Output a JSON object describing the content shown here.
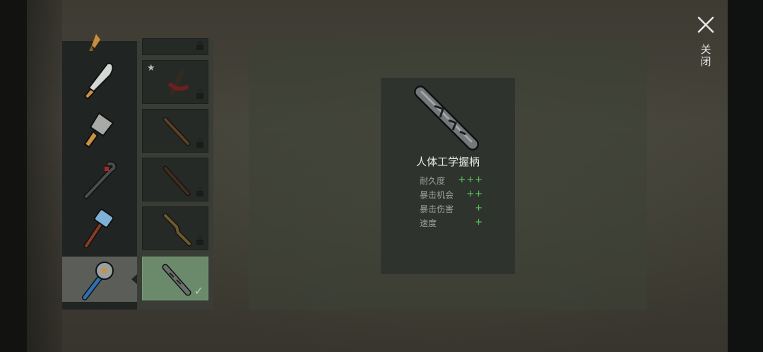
{
  "screen": "handle-selection",
  "close": {
    "label": "关闭",
    "icon": "close-icon"
  },
  "weapons": [
    {
      "name": "partial-blade",
      "icon": "partial-weapon-icon",
      "selected": false
    },
    {
      "name": "machete",
      "icon": "machete-icon",
      "selected": false
    },
    {
      "name": "cleaver",
      "icon": "cleaver-icon",
      "selected": false
    },
    {
      "name": "crowbar",
      "icon": "crowbar-icon",
      "selected": false
    },
    {
      "name": "sledgehammer",
      "icon": "hammer-icon",
      "selected": false
    },
    {
      "name": "saw-blade-club",
      "icon": "saw-club-icon",
      "selected": true
    }
  ],
  "handles": [
    {
      "icon": "handle-partial-icon",
      "locked": true,
      "starred": false,
      "equipped": false
    },
    {
      "icon": "red-wrapped-handle-icon",
      "locked": true,
      "starred": true,
      "equipped": false
    },
    {
      "icon": "wooden-handle-icon",
      "locked": true,
      "starred": false,
      "equipped": false
    },
    {
      "icon": "dark-wooden-handle-icon",
      "locked": true,
      "starred": false,
      "equipped": false
    },
    {
      "icon": "branch-handle-icon",
      "locked": true,
      "starred": false,
      "equipped": false
    },
    {
      "icon": "ergonomic-grip-icon",
      "locked": false,
      "starred": false,
      "equipped": true
    }
  ],
  "detail": {
    "icon": "ergonomic-grip-icon",
    "name": "人体工学握柄",
    "stats": [
      {
        "label": "耐久度",
        "value": "+++"
      },
      {
        "label": "暴击机会",
        "value": "++"
      },
      {
        "label": "暴击伤害",
        "value": "+"
      },
      {
        "label": "速度",
        "value": "+"
      }
    ]
  },
  "colors": {
    "accent_positive": "#58c858",
    "equipped_bg": "#6b8a6c",
    "selected_bg": "#5a5d58"
  }
}
